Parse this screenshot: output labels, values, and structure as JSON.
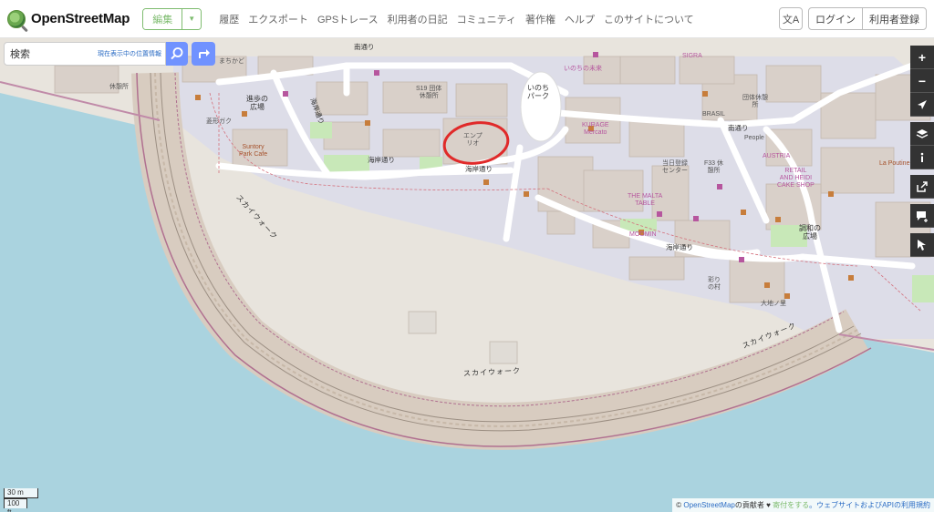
{
  "header": {
    "brand": "OpenStreetMap",
    "edit_label": "編集",
    "edit_caret": "▼",
    "nav": [
      "履歴",
      "エクスポート",
      "GPSトレース",
      "利用者の日記",
      "コミュニティ",
      "著作権",
      "ヘルプ",
      "このサイトについて"
    ],
    "lang_icon": "文A",
    "login": "ログイン",
    "signup": "利用者登録"
  },
  "search": {
    "placeholder": "検索",
    "where_am_i": "現在表示中の位置情報"
  },
  "map": {
    "labels": {
      "osanpo_hiroba": "進歩の\n広場",
      "kaigan_dori": "海岸通り",
      "minami_dori": "南通り",
      "inochi_park": "いのち\nパーク",
      "empurio": "エンプ\nリオ",
      "signature_pavilion": "いのちの未来",
      "kurage": "KURAGE\nMercato",
      "malta": "THE MALTA\nTABLE",
      "moomin": "MOOMIN",
      "austria": "AUSTRIA",
      "retail": "RETAIL\nAND HEIDI\nCAKE SHOP",
      "brasil": "BRASIL",
      "sigra": "SIGRA",
      "people": "People",
      "chowa_hiroba": "調和の\n広場",
      "sky_walk": "スカイウォーク",
      "sunton": "Suntory\nPark Cafe",
      "lapoutine": "La Poutine",
      "s19": "S19 団体\n休憩所",
      "f33": "F33 休\n憩所",
      "touroku": "当日登録\nセンター",
      "kyukei": "休憩所",
      "kyukei_dantai": "団体休憩\n所",
      "sainou": "彩り\nの村",
      "daiou_hall": "大地ノ里",
      "machikado": "まちかど",
      "hishi": "菱形ガク"
    }
  },
  "scale": {
    "metric": "30 m",
    "imperial": "100 ft"
  },
  "attribution": {
    "prefix": "© ",
    "osm_link": "OpenStreetMap",
    "contributors": "の貢献者",
    "heart": "♥",
    "donate": "寄付をする",
    "suffix": "。ウェブサイトおよびAPIの利用規約"
  },
  "controls": {
    "zoom_in": "+",
    "zoom_out": "−"
  }
}
